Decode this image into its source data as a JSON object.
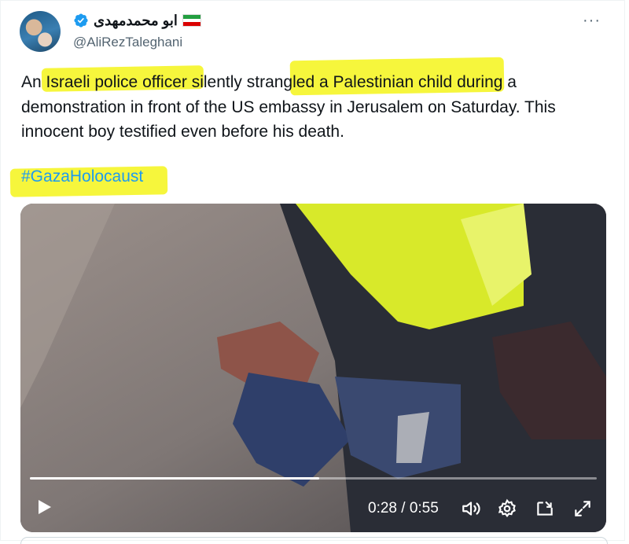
{
  "author": {
    "display_name": "ابو محمدمهدی",
    "flag_icon": "iran-flag-icon",
    "verified_icon": "verified-badge-icon",
    "handle": "@AliRezTaleghani"
  },
  "more_menu": {
    "label": "···"
  },
  "tweet": {
    "text": "An Israeli police officer silently strangled a Palestinian child during a demonstration in front of the US embassy in Jerusalem on Saturday. This innocent boy testified even before his death.",
    "hashtag": "#GazaHolocaust"
  },
  "highlight_color": "#f5f51a",
  "link_color": "#1d9bf0",
  "video": {
    "progress": 0.51,
    "time_display": "0:28 / 0:55",
    "controls": [
      "play-icon",
      "volume-icon",
      "settings-gear-icon",
      "picture-in-picture-icon",
      "fullscreen-expand-icon"
    ]
  }
}
